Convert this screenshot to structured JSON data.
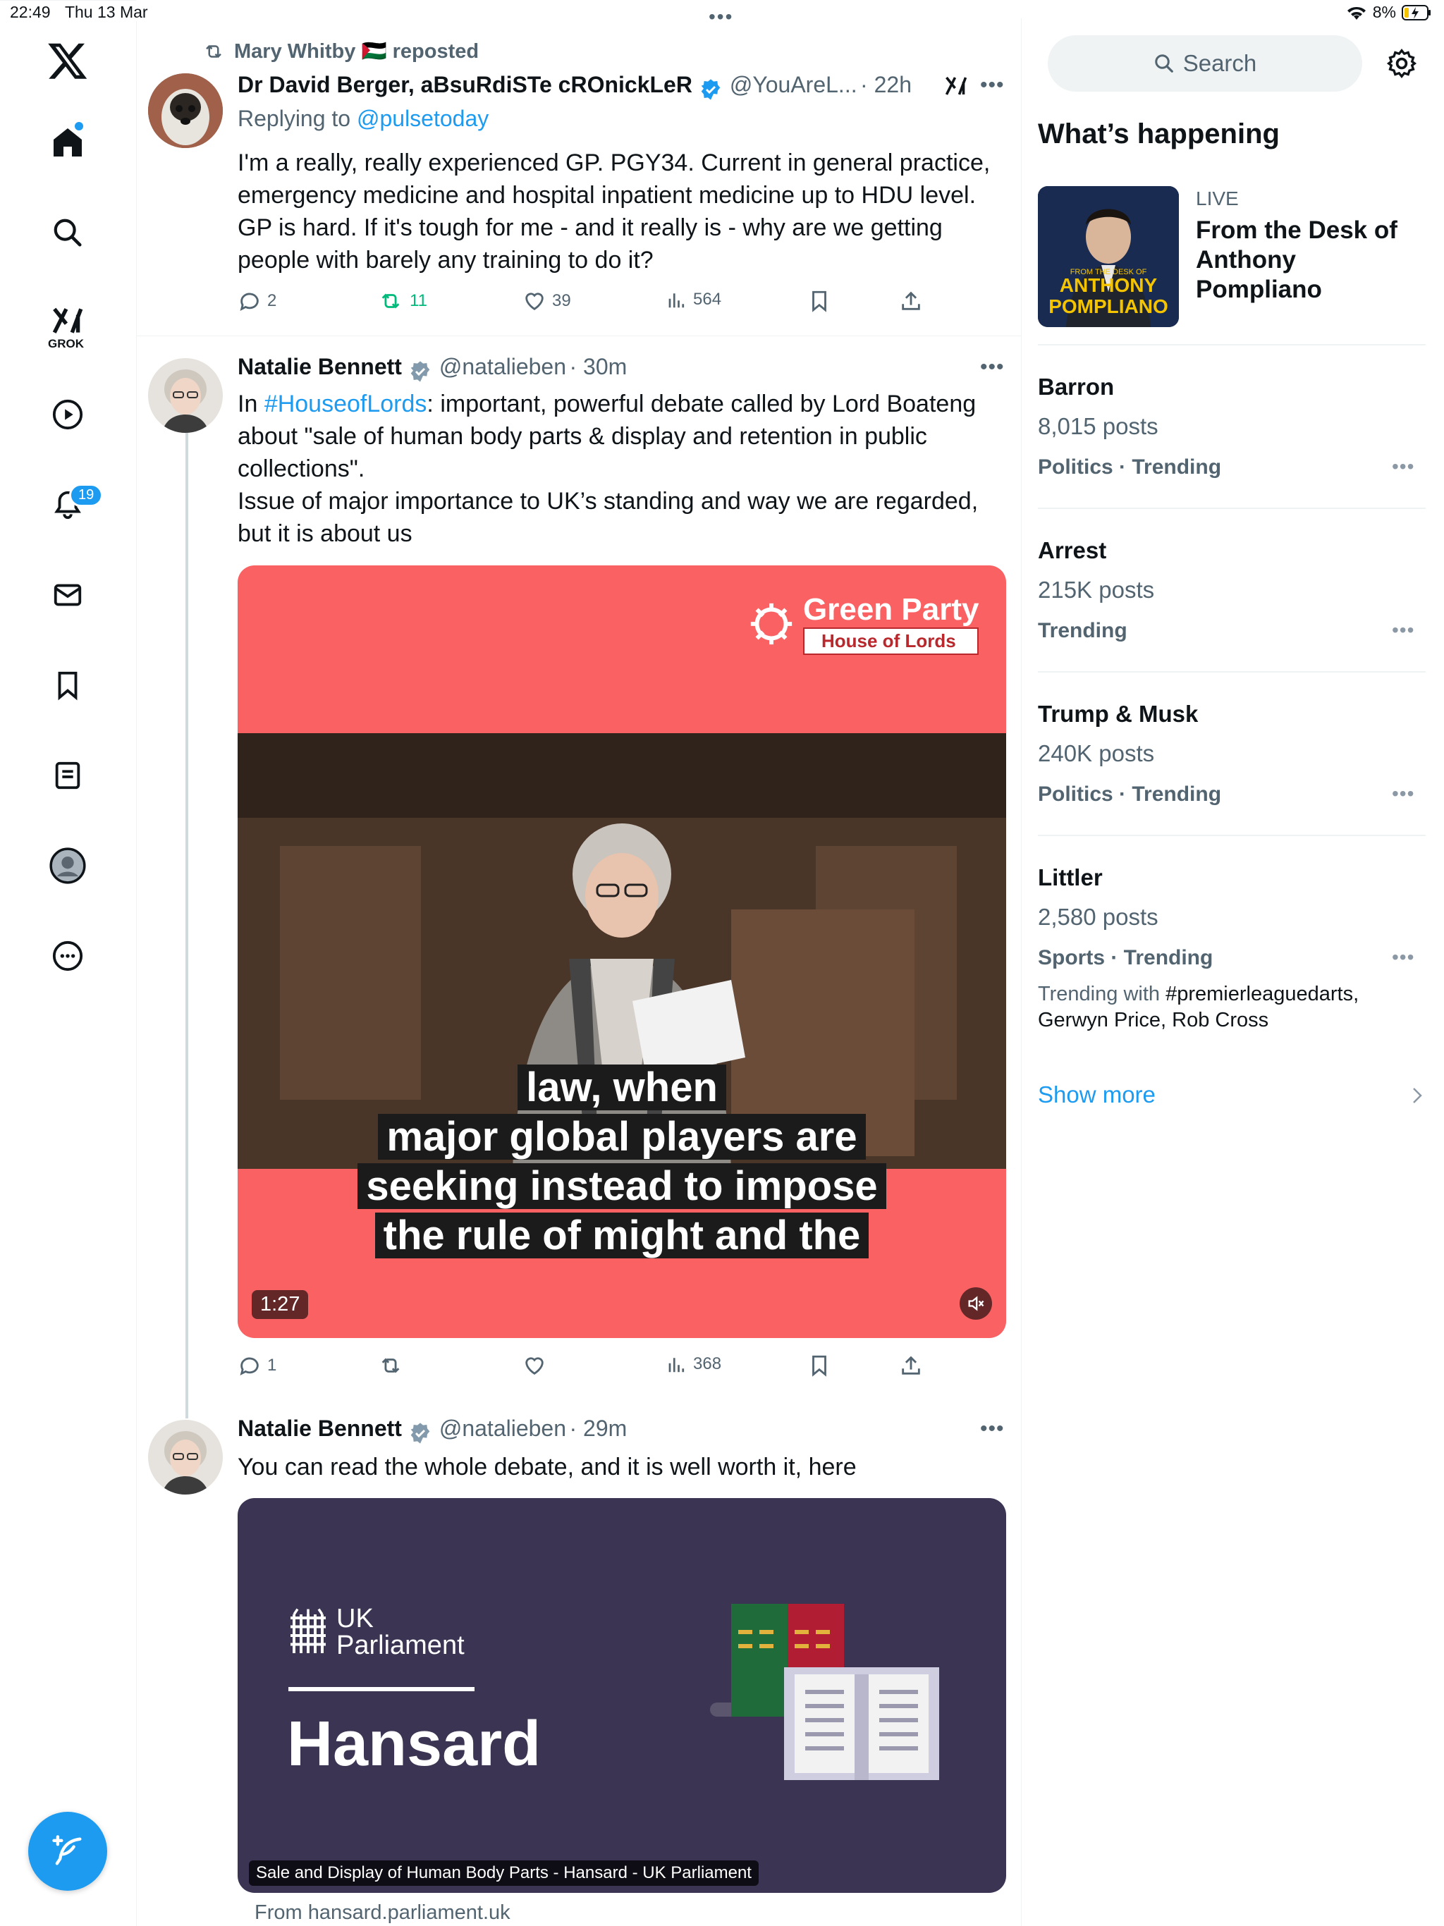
{
  "status_bar": {
    "time": "22:49",
    "date": "Thu 13 Mar",
    "battery": "8%",
    "center_dots": "•••"
  },
  "nav": {
    "grok_label": "GROK",
    "notifications_badge": "19",
    "items": [
      "home",
      "search",
      "grok",
      "video",
      "notifications",
      "messages",
      "bookmarks",
      "lists",
      "profile",
      "more"
    ]
  },
  "tweet1": {
    "repost_label": "Mary Whitby 🇵🇸 reposted",
    "name": "Dr David Berger, aBsuRdiSTe cROnickLeR",
    "handle": "@YouAreL...",
    "time": "· 22h",
    "replying_prefix": "Replying to ",
    "replying_to": "@pulsetoday",
    "text": "I'm a really, really experienced GP. PGY34. Current in general practice, emergency medicine and hospital inpatient medicine up to HDU level. GP is hard. If it's tough for me - and it really is - why are we getting people with barely any training to do it?",
    "replies": "2",
    "reposts": "11",
    "likes": "39",
    "views": "564",
    "more": "•••"
  },
  "tweet2": {
    "name": "Natalie Bennett",
    "handle": "@natalieben",
    "time": "· 30m",
    "hashtag": "#HouseofLords",
    "text_after_hashtag": ": important, powerful debate called by Lord Boateng about \"sale of human body parts & display and retention in public collections\".",
    "text_line2": "Issue of major importance to UK’s standing and way we are regarded, but it is about us",
    "text_prefix": "In ",
    "replies": "1",
    "reposts": "",
    "likes": "",
    "views": "368",
    "more": "•••",
    "video": {
      "brand": "Green Party",
      "brand_sub": "House of Lords",
      "captions": [
        "law, when",
        "major global players are",
        "seeking instead to impose",
        "the rule of might and the"
      ],
      "duration": "1:27"
    }
  },
  "tweet3": {
    "name": "Natalie Bennett",
    "handle": "@natalieben",
    "time": "· 29m",
    "text": "You can read the whole debate, and it is well worth it, here",
    "more": "•••",
    "card": {
      "org_line1": "UK",
      "org_line2": "Parliament",
      "title": "Hansard",
      "caption": "Sale and Display of Human Body Parts - Hansard - UK Parliament",
      "from": "From hansard.parliament.uk"
    }
  },
  "sidebar": {
    "search_placeholder": "Search",
    "heading": "What’s happening",
    "live": {
      "tag": "LIVE",
      "title": "From the Desk of Anthony Pompliano",
      "thumb_small": "FROM THE DESK OF",
      "thumb_big1": "ANTHONY",
      "thumb_big2": "POMPLIANO"
    },
    "trends": [
      {
        "title": "Barron",
        "count": "8,015 posts",
        "category": "Politics · Trending"
      },
      {
        "title": "Arrest",
        "count": "215K posts",
        "category": "Trending"
      },
      {
        "title": "Trump & Musk",
        "count": "240K posts",
        "category": "Politics · Trending"
      },
      {
        "title": "Littler",
        "count": "2,580 posts",
        "category": "Sports · Trending",
        "with_prefix": "Trending with ",
        "with_tag": "#premierleaguedarts,",
        "with_rest": "Gerwyn Price, Rob Cross"
      }
    ],
    "trend_more": "•••",
    "show_more": "Show more"
  },
  "colors": {
    "accent": "#1d9bf0",
    "repost_green": "#00ba7c",
    "text": "#0f1419",
    "muted": "#536471",
    "video_red": "#f96163",
    "hansard_bg": "#3b3453"
  }
}
